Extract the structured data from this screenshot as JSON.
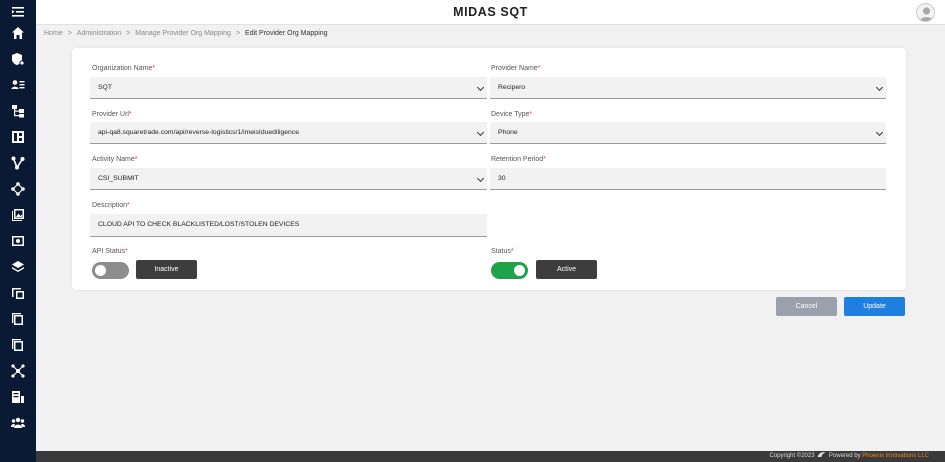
{
  "app": {
    "title": "MIDAS SQT"
  },
  "breadcrumb": [
    "Home",
    "Administration",
    "Manage Provider Org Mapping",
    "Edit Provider Org Mapping"
  ],
  "sidebar": {
    "icons": [
      "menu-collapse-icon",
      "home-icon",
      "settings-shield-icon",
      "user-list-icon",
      "hierarchy-icon",
      "dashboard-icon",
      "branch-icon",
      "network-icon",
      "gallery-icon",
      "monitor-icon",
      "layers-icon",
      "devices-icon",
      "copy-icon",
      "pages-icon",
      "nodes-icon",
      "report-icon",
      "team-icon"
    ]
  },
  "form": {
    "organization_name": {
      "label": "Organization Name",
      "value": "SQT"
    },
    "provider_name": {
      "label": "Provider Name",
      "value": "Recipero"
    },
    "provider_url": {
      "label": "Provider Url",
      "value": "api-qa8.squaretrade.com/api/reverse-logistics/1/imeisIduediligence"
    },
    "device_type": {
      "label": "Device Type",
      "value": "Phone"
    },
    "activity_name": {
      "label": "Activity Name",
      "value": "CSI_SUBMIT"
    },
    "retention_period": {
      "label": "Retention Period",
      "value": "30"
    },
    "description": {
      "label": "Description",
      "value": "CLOUD API TO CHECK BLACKLISTED/LOST/STOLEN DEVICES"
    },
    "api_status": {
      "label": "API Status",
      "state": "Inactive",
      "enabled": false
    },
    "status": {
      "label": "Status",
      "state": "Active",
      "enabled": true
    },
    "required_marker": "*"
  },
  "actions": {
    "cancel": "Cancel",
    "update": "Update"
  },
  "footer": {
    "copyright": "Copyright ©2023",
    "powered": "Powered by",
    "brand": "Phoenix Innovations LLC"
  },
  "colors": {
    "sidebar": "#0a1a35",
    "toggle_on": "#1fa34a",
    "update_button": "#1e7fe0",
    "required": "#e53935",
    "footer_brand": "#f58220"
  }
}
